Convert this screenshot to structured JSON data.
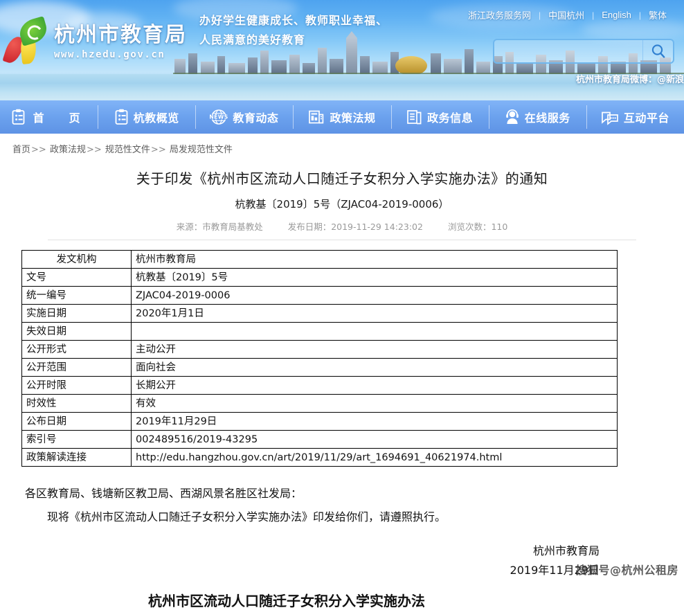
{
  "site": {
    "logo_title": "杭州市教育局",
    "logo_url": "www.hzedu.gov.cn",
    "slogan_line1": "办好学生健康成长、教师职业幸福、",
    "slogan_line2": "人民满意的美好教育",
    "weibo": "杭州市教育局微博：@新浪",
    "accent_blue": "#5e93e5",
    "banner_blue": "#4ea3ef"
  },
  "toplinks": [
    {
      "label": "浙江政务服务网"
    },
    {
      "label": "中国杭州"
    },
    {
      "label": "English"
    },
    {
      "label": "繁体"
    }
  ],
  "search": {
    "value": "",
    "placeholder": "",
    "button_icon": "search-icon"
  },
  "nav": [
    {
      "label": "首　页",
      "icon": "clipboard-icon"
    },
    {
      "label": "杭教概览",
      "icon": "clipboard-icon"
    },
    {
      "label": "教育动态",
      "icon": "news-globe-icon"
    },
    {
      "label": "政策法规",
      "icon": "document-chart-icon"
    },
    {
      "label": "政务信息",
      "icon": "document-lines-icon"
    },
    {
      "label": "在线服务",
      "icon": "headset-person-icon"
    },
    {
      "label": "互动平台",
      "icon": "chat-bubble-icon"
    }
  ],
  "breadcrumb": {
    "items": [
      "首页",
      "政策法规",
      "规范性文件",
      "局发规范性文件"
    ],
    "separator": ">>"
  },
  "document": {
    "title": "关于印发《杭州市区流动人口随迁子女积分入学实施办法》的通知",
    "subtitle": "杭教基〔2019〕5号（ZJAC04-2019-0006）",
    "meta": {
      "source_label": "来源：市教育局基教处",
      "publish_label": "发布日期：2019-11-29 14:23:02",
      "views_label": "浏览次数：110"
    },
    "table": [
      {
        "key": "发文机构",
        "value": "杭州市教育局",
        "style": "normal"
      },
      {
        "key": "文号",
        "value": "杭教基〔2019〕5号",
        "style": "normal"
      },
      {
        "key": "统一编号",
        "value": "ZJAC04-2019-0006",
        "style": "normal"
      },
      {
        "key": "实施日期",
        "value": "2020年1月1日",
        "style": "normal"
      },
      {
        "key": "失效日期",
        "value": "",
        "style": "normal"
      },
      {
        "key": "公开形式",
        "value": "主动公开",
        "style": "normal"
      },
      {
        "key": "公开范围",
        "value": "面向社会",
        "style": "normal"
      },
      {
        "key": "公开时限",
        "value": "长期公开",
        "style": "normal"
      },
      {
        "key": "时效性",
        "value": "有效",
        "style": "normal"
      },
      {
        "key": "公布日期",
        "value": "2019年11月29日",
        "style": "normal"
      },
      {
        "key": "索引号",
        "value": "002489516/2019-43295",
        "style": "gray"
      },
      {
        "key": "政策解读连接",
        "value": "http://edu.hangzhou.gov.cn/art/2019/11/29/art_1694691_40621974.html",
        "style": "link"
      }
    ],
    "body": {
      "addressee": "各区教育局、钱塘新区教卫局、西湖风景名胜区社发局：",
      "paragraph": "现将《杭州市区流动人口随迁子女积分入学实施办法》印发给你们，请遵照执行。",
      "sign_org": "杭州市教育局",
      "sign_date": "2019年11月29日",
      "attachment_title": "杭州市区流动人口随迁子女积分入学实施办法"
    }
  },
  "watermark": "搜狐号@杭州公租房"
}
